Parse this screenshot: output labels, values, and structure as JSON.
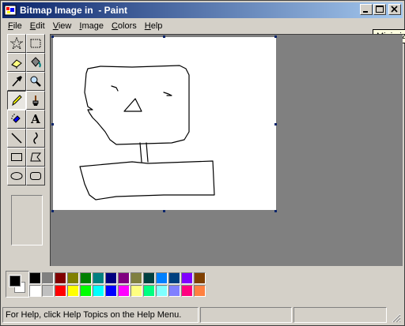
{
  "window": {
    "title": "Bitmap Image in  - Paint",
    "tooltip": "Minimize"
  },
  "menu": [
    {
      "label": "File",
      "key": "F"
    },
    {
      "label": "Edit",
      "key": "E"
    },
    {
      "label": "View",
      "key": "V"
    },
    {
      "label": "Image",
      "key": "I"
    },
    {
      "label": "Colors",
      "key": "C"
    },
    {
      "label": "Help",
      "key": "H"
    }
  ],
  "tools": [
    {
      "name": "free-form-select-tool",
      "icon": "star-select-icon",
      "active": false
    },
    {
      "name": "select-tool",
      "icon": "rect-select-icon",
      "active": false
    },
    {
      "name": "eraser-tool",
      "icon": "eraser-icon",
      "active": false
    },
    {
      "name": "fill-tool",
      "icon": "fill-bucket-icon",
      "active": false
    },
    {
      "name": "pick-color-tool",
      "icon": "eyedropper-icon",
      "active": false
    },
    {
      "name": "magnifier-tool",
      "icon": "magnifier-icon",
      "active": false
    },
    {
      "name": "pencil-tool",
      "icon": "pencil-icon",
      "active": true
    },
    {
      "name": "brush-tool",
      "icon": "brush-icon",
      "active": false
    },
    {
      "name": "airbrush-tool",
      "icon": "airbrush-icon",
      "active": false
    },
    {
      "name": "text-tool",
      "icon": "text-icon",
      "active": false,
      "glyph": "A"
    },
    {
      "name": "line-tool",
      "icon": "line-icon",
      "active": false
    },
    {
      "name": "curve-tool",
      "icon": "curve-icon",
      "active": false
    },
    {
      "name": "rectangle-tool",
      "icon": "rectangle-icon",
      "active": false
    },
    {
      "name": "polygon-tool",
      "icon": "polygon-icon",
      "active": false
    },
    {
      "name": "ellipse-tool",
      "icon": "ellipse-icon",
      "active": false
    },
    {
      "name": "rounded-rectangle-tool",
      "icon": "rounded-rectangle-icon",
      "active": false
    }
  ],
  "colors": {
    "foreground": "#000000",
    "background": "#ffffff",
    "palette_top": [
      "#000000",
      "#808080",
      "#800000",
      "#808000",
      "#008000",
      "#008080",
      "#000080",
      "#800080",
      "#808040",
      "#004040",
      "#0080ff",
      "#004080",
      "#8000ff",
      "#804000"
    ],
    "palette_bottom": [
      "#ffffff",
      "#c0c0c0",
      "#ff0000",
      "#ffff00",
      "#00ff00",
      "#00ffff",
      "#0000ff",
      "#ff00ff",
      "#ffff80",
      "#00ff80",
      "#80ffff",
      "#8080ff",
      "#ff0080",
      "#ff8040"
    ]
  },
  "status": {
    "help_text": "For Help, click Help Topics on the Help Menu."
  }
}
